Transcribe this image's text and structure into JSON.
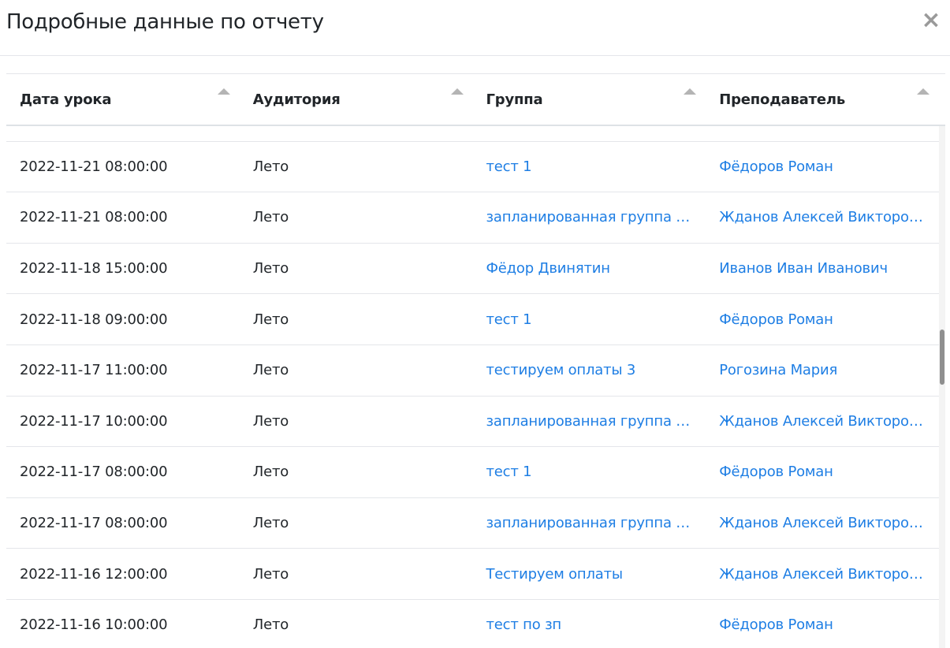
{
  "modal": {
    "title": "Подробные данные по отчету",
    "close_glyph": "×"
  },
  "table": {
    "columns": [
      {
        "label": "Дата урока"
      },
      {
        "label": "Аудитория"
      },
      {
        "label": "Группа"
      },
      {
        "label": "Преподаватель"
      }
    ],
    "rows": [
      {
        "date": "",
        "room": "",
        "group": "",
        "teacher": ""
      },
      {
        "date": "2022-11-21 08:00:00",
        "room": "Лето",
        "group": "тест 1",
        "teacher": "Фёдоров Роман"
      },
      {
        "date": "2022-11-21 08:00:00",
        "room": "Лето",
        "group": "запланированная группа д...",
        "teacher": "Жданов Алексей Викторов..."
      },
      {
        "date": "2022-11-18 15:00:00",
        "room": "Лето",
        "group": "Фёдор Двинятин",
        "teacher": "Иванов Иван Иванович"
      },
      {
        "date": "2022-11-18 09:00:00",
        "room": "Лето",
        "group": "тест 1",
        "teacher": "Фёдоров Роман"
      },
      {
        "date": "2022-11-17 11:00:00",
        "room": "Лето",
        "group": "тестируем оплаты 3",
        "teacher": "Рогозина Мария"
      },
      {
        "date": "2022-11-17 10:00:00",
        "room": "Лето",
        "group": "запланированная группа д...",
        "teacher": "Жданов Алексей Викторов..."
      },
      {
        "date": "2022-11-17 08:00:00",
        "room": "Лето",
        "group": "тест 1",
        "teacher": "Фёдоров Роман"
      },
      {
        "date": "2022-11-17 08:00:00",
        "room": "Лето",
        "group": "запланированная группа д...",
        "teacher": "Жданов Алексей Викторов..."
      },
      {
        "date": "2022-11-16 12:00:00",
        "room": "Лето",
        "group": "Тестируем оплаты",
        "teacher": "Жданов Алексей Викторов..."
      },
      {
        "date": "2022-11-16 10:00:00",
        "room": "Лето",
        "group": "тест по зп",
        "teacher": "Фёдоров Роман"
      }
    ]
  },
  "colors": {
    "link": "#1e7ee4",
    "text": "#212529",
    "border": "#e4e6ea",
    "sort_icon": "#b4b4b4"
  },
  "icons": {
    "close": "close-icon",
    "sort": "sort-ascending-icon"
  }
}
